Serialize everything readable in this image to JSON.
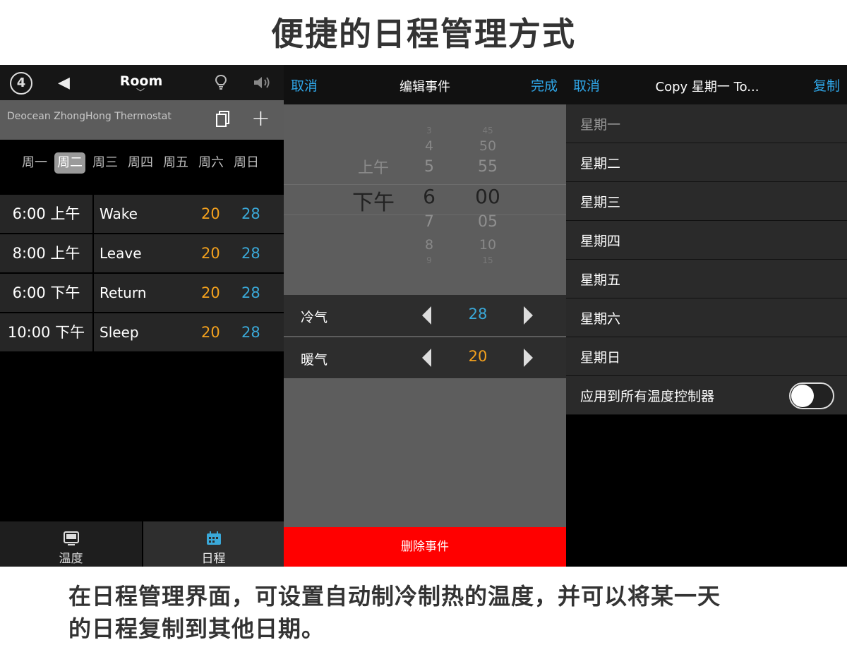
{
  "title": "便捷的日程管理方式",
  "caption_line1": "在日程管理界面，可设置自动制冷制热的温度，并可以将某一天",
  "caption_line2": "的日程复制到其他日期。",
  "colors": {
    "accent_blue": "#2fa6e8",
    "heat_orange": "#f4a11d",
    "cool_blue": "#3aa8d8",
    "delete_red": "#ff0000"
  },
  "panel1": {
    "header": {
      "room": "Room",
      "logo_glyph": "4"
    },
    "device": {
      "name": "Deocean ZhongHong Thermostat",
      "add_glyph": "+"
    },
    "days": [
      "周一",
      "周二",
      "周三",
      "周四",
      "周五",
      "周六",
      "周日"
    ],
    "selected_day": "周二",
    "events": [
      {
        "time": "6:00 上午",
        "name": "Wake",
        "heat": "20",
        "cool": "28"
      },
      {
        "time": "8:00 上午",
        "name": "Leave",
        "heat": "20",
        "cool": "28"
      },
      {
        "time": "6:00 下午",
        "name": "Return",
        "heat": "20",
        "cool": "28"
      },
      {
        "time": "10:00 下午",
        "name": "Sleep",
        "heat": "20",
        "cool": "28"
      }
    ],
    "tabs": [
      {
        "label": "温度"
      },
      {
        "label": "日程"
      }
    ]
  },
  "panel2": {
    "cancel": "取消",
    "title": "编辑事件",
    "done": "完成",
    "picker": {
      "ampm": [
        "上午",
        "下午"
      ],
      "hours": [
        "3",
        "4",
        "5",
        "6",
        "7",
        "8",
        "9"
      ],
      "minutes": [
        "45",
        "50",
        "55",
        "00",
        "05",
        "10",
        "15"
      ],
      "selected": {
        "ampm": "下午",
        "hour": "6",
        "minute": "00"
      }
    },
    "cool": {
      "label": "冷气",
      "value": "28"
    },
    "heat": {
      "label": "暖气",
      "value": "20"
    },
    "delete": "删除事件"
  },
  "panel3": {
    "cancel": "取消",
    "title": "Copy 星期一 To...",
    "copy": "复制",
    "days": [
      "星期一",
      "星期二",
      "星期三",
      "星期四",
      "星期五",
      "星期六",
      "星期日"
    ],
    "apply_all": "应用到所有温度控制器",
    "apply_all_on": false
  }
}
